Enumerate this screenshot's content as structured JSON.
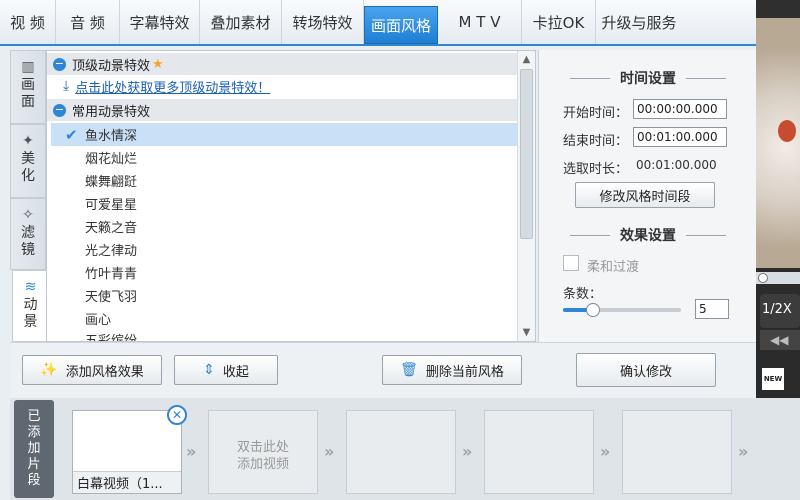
{
  "tabs": [
    {
      "label": "视  频",
      "active": false
    },
    {
      "label": "音  频",
      "active": false
    },
    {
      "label": "字幕特效",
      "active": false
    },
    {
      "label": "叠加素材",
      "active": false
    },
    {
      "label": "转场特效",
      "active": false
    },
    {
      "label": "画面风格",
      "active": true
    },
    {
      "label": "M T V",
      "active": false
    },
    {
      "label": "卡拉OK",
      "active": false
    },
    {
      "label": "升级与服务",
      "active": false
    }
  ],
  "side_tabs": [
    {
      "label": "画面",
      "icon": "film-strip-icon"
    },
    {
      "label": "美化",
      "icon": "magic-wand-icon"
    },
    {
      "label": "滤镜",
      "icon": "filter-wand-icon"
    },
    {
      "label": "动景",
      "icon": "wave-icon",
      "active": true
    }
  ],
  "list": {
    "section_top": "顶级动景特效",
    "download_link": "点击此处获取更多顶级动景特效！",
    "section_common": "常用动景特效",
    "items": [
      "鱼水情深",
      "烟花灿烂",
      "蝶舞翩跹",
      "可爱星星",
      "天籁之音",
      "光之律动",
      "竹叶青青",
      "天使飞羽",
      "画心",
      "五彩缤纷"
    ],
    "selected_index": 0
  },
  "settings": {
    "time_title": "时间设置",
    "start_label": "开始时间：",
    "start_value": "00:00:00.000",
    "end_label": "结束时间：",
    "end_value": "00:01:00.000",
    "duration_label": "选取时长：",
    "duration_value": "00:01:00.000",
    "modify_time_button": "修改风格时间段",
    "effect_title": "效果设置",
    "smooth_label": "柔和过渡",
    "count_label": "条数：",
    "count_value": "5",
    "count_fraction": 0.25,
    "confirm_button": "确认修改"
  },
  "actions": {
    "add": "添加风格效果",
    "collapse": "收起",
    "delete": "删除当前风格"
  },
  "timeline": {
    "label": "已添加片段",
    "clip1": "白幕视频（1...",
    "add_hint_1": "双击此处",
    "add_hint_2": "添加视频"
  },
  "preview": {
    "speed": "1/2X"
  },
  "colors": {
    "accent": "#2f86d6",
    "link": "#1a5fb4",
    "selection": "#c9e0f7"
  }
}
